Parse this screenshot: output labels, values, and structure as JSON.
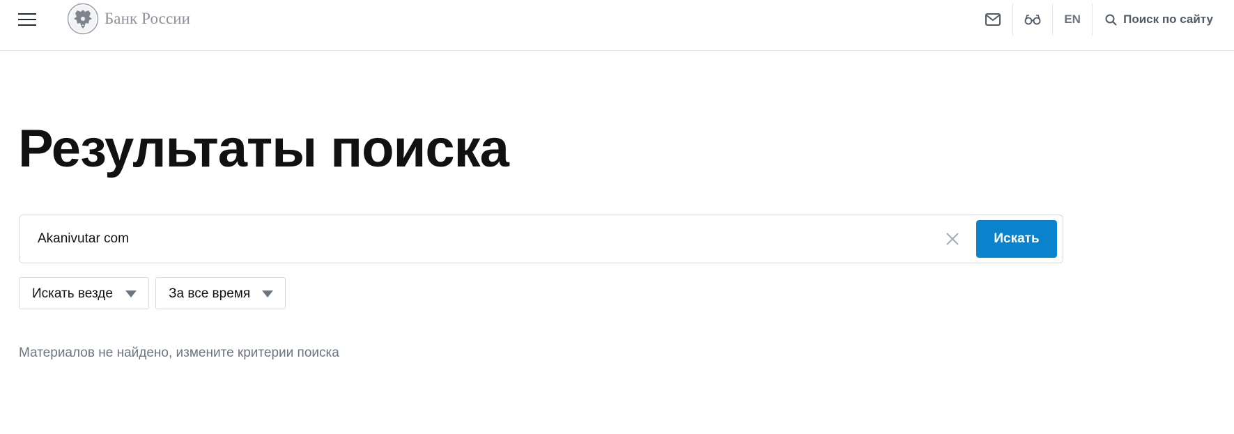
{
  "header": {
    "logo_text": "Банк России",
    "logo_icon": "double-headed-eagle-emblem",
    "menu_icon": "hamburger-icon",
    "mail_icon": "mail-icon",
    "accessibility_icon": "glasses-icon",
    "lang_label": "EN",
    "search_label": "Поиск по сайту",
    "search_icon": "search-icon"
  },
  "page": {
    "title": "Результаты поиска"
  },
  "search": {
    "query": "Akanivutar com",
    "clear_icon": "close-icon",
    "submit_label": "Искать"
  },
  "filters": [
    {
      "label": "Искать везде",
      "icon": "triangle-down-icon"
    },
    {
      "label": "За все время",
      "icon": "triangle-down-icon"
    }
  ],
  "results": {
    "empty_message": "Материалов не найдено, измените критерии поиска"
  },
  "colors": {
    "accent": "#0a83cc",
    "muted_text": "#6b7581",
    "border": "#d5d9de",
    "logo_gray": "#8b929b"
  }
}
